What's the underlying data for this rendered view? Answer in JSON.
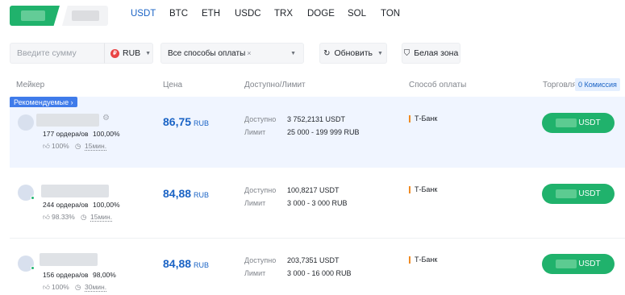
{
  "tabs": [
    "USDT",
    "BTC",
    "ETH",
    "USDC",
    "TRX",
    "DOGE",
    "SOL",
    "TON"
  ],
  "active_tab": "USDT",
  "filters": {
    "amount_placeholder": "Введите сумму",
    "currency": "RUB",
    "payment": "Все способы оплаты",
    "refresh": "Обновить",
    "white_zone": "Белая зона"
  },
  "columns": {
    "maker": "Мейкер",
    "price": "Цена",
    "available": "Доступно/Лимит",
    "payment": "Способ оплаты",
    "trade": "Торговля",
    "commission": "0 Комиссия"
  },
  "recommended": "Рекомендуемые",
  "rows": [
    {
      "orders": "177 ордера/ов",
      "completion": "100,00%",
      "rating": "100%",
      "time": "15мин.",
      "price": "86,75",
      "price_unit": "RUB",
      "available_label": "Доступно",
      "available": "3 752,2131 USDT",
      "limit_label": "Лимит",
      "limit": "25 000 - 199 999 RUB",
      "payment": "Т-Банк",
      "btn": "USDT"
    },
    {
      "orders": "244 ордера/ов",
      "completion": "100,00%",
      "rating": "98.33%",
      "time": "15мин.",
      "price": "84,88",
      "price_unit": "RUB",
      "available_label": "Доступно",
      "available": "100,8217 USDT",
      "limit_label": "Лимит",
      "limit": "3 000 - 3 000 RUB",
      "payment": "Т-Банк",
      "btn": "USDT"
    },
    {
      "orders": "156 ордера/ов",
      "completion": "98,00%",
      "rating": "100%",
      "time": "30мин.",
      "price": "84,88",
      "price_unit": "RUB",
      "available_label": "Доступно",
      "available": "203,7351 USDT",
      "limit_label": "Лимит",
      "limit": "3 000 - 16 000 RUB",
      "payment": "Т-Банк",
      "btn": "USDT"
    }
  ],
  "colors": {
    "accent": "#1a63c5",
    "buy": "#20b26c",
    "payment_marker": "#f08b23",
    "recommended": "#3f7bea"
  }
}
